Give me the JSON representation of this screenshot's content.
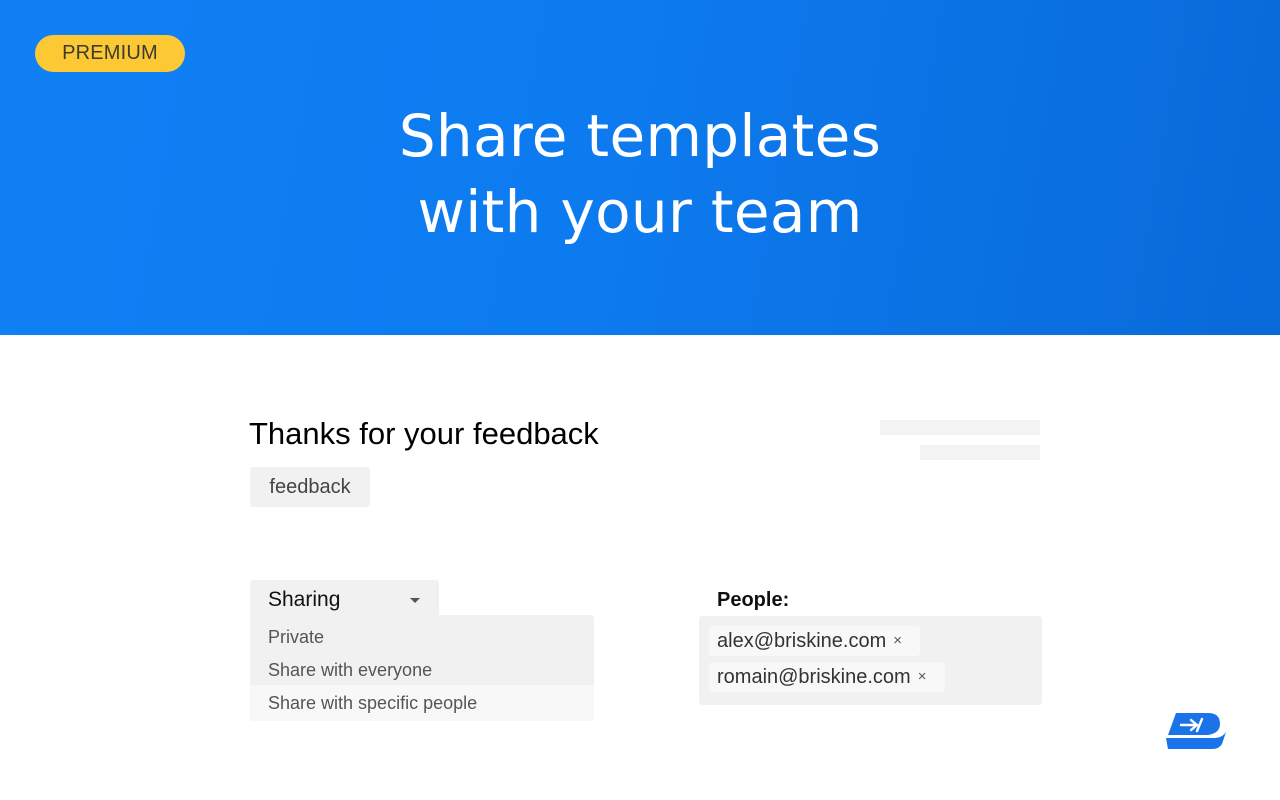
{
  "hero": {
    "badge": "PREMIUM",
    "title_line1": "Share templates",
    "title_line2": "with your team"
  },
  "template": {
    "title": "Thanks for your feedback",
    "tag": "feedback"
  },
  "sharing": {
    "selected_label": "Sharing",
    "options": [
      "Private",
      "Share with everyone",
      "Share with specific people"
    ]
  },
  "people": {
    "label": "People:",
    "emails": [
      "alex@briskine.com",
      "romain@briskine.com"
    ],
    "remove_glyph": "×"
  },
  "icons": {
    "dropdown": "caret-down-icon",
    "logo": "briskine-logo-icon"
  },
  "colors": {
    "hero_blue": "#0d7bf0",
    "badge_yellow": "#fcc934",
    "logo_blue": "#1a73e8"
  }
}
